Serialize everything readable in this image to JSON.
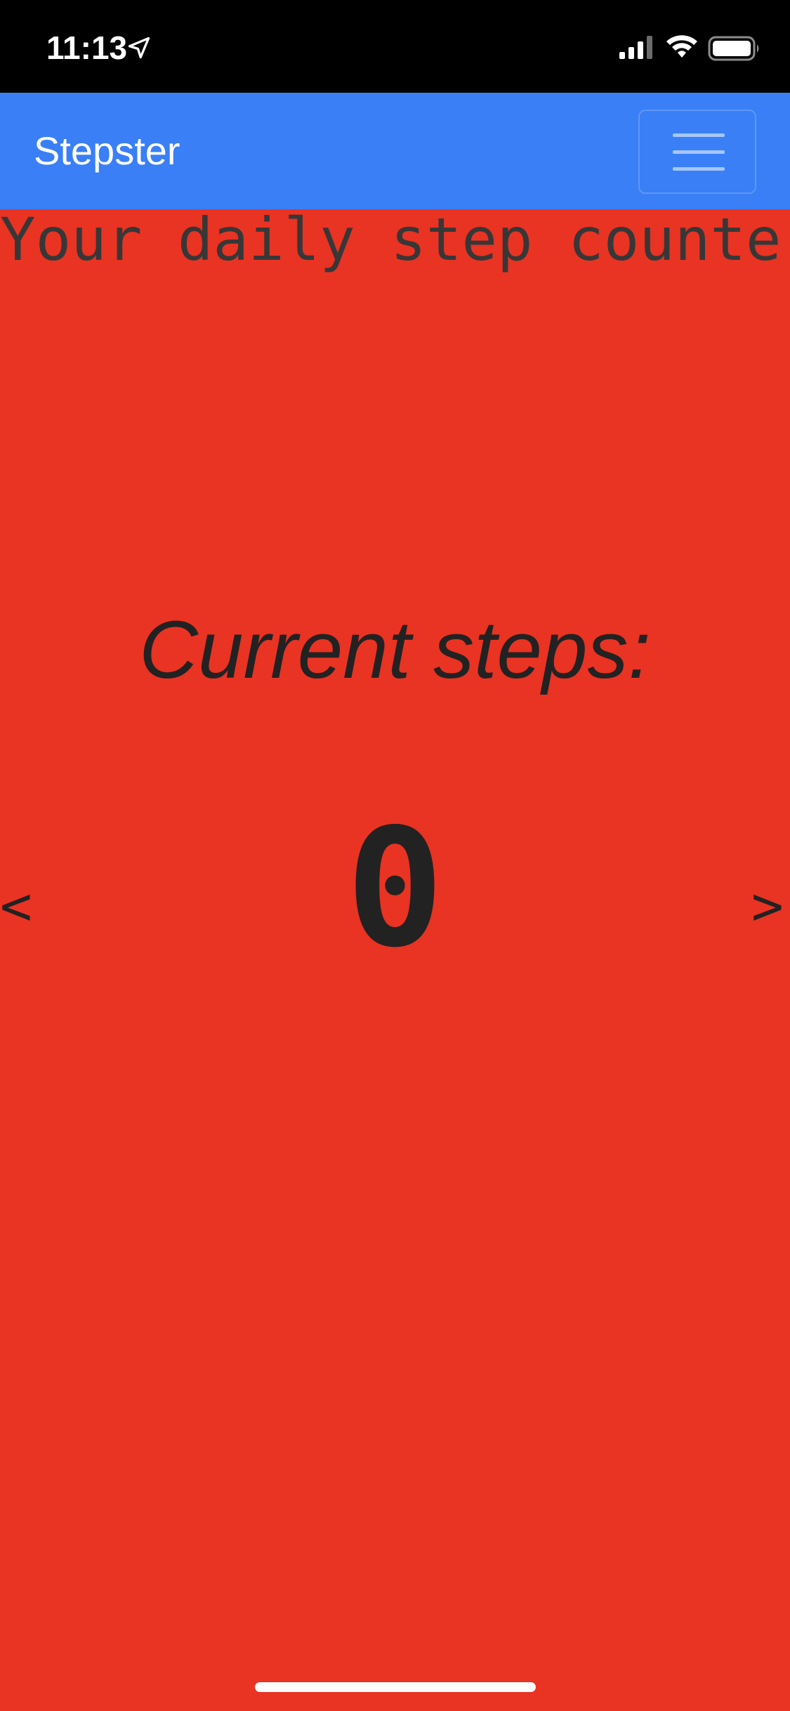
{
  "status_bar": {
    "time": "11:13",
    "icons": [
      "location-arrow-icon",
      "signal-icon",
      "wifi-icon",
      "battery-icon"
    ]
  },
  "navbar": {
    "brand": "Stepster",
    "menu_icon": "hamburger-menu-icon",
    "color": "#3A7FF6"
  },
  "main": {
    "subtitle": "Your daily step counter",
    "steps_label": "Current steps:",
    "step_count": "0",
    "prev_label": "<",
    "next_label": ">",
    "background_color": "#E93323"
  }
}
